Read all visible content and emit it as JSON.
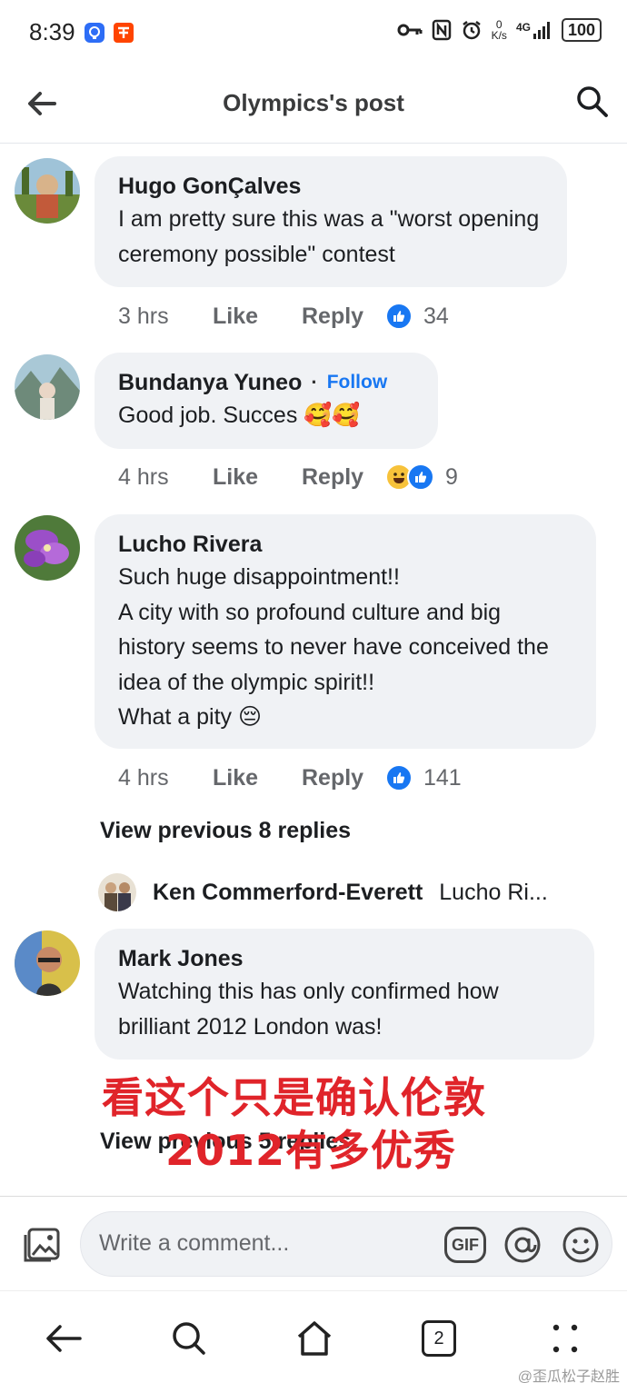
{
  "status_bar": {
    "time": "8:39",
    "net_speed_top": "0",
    "net_speed_bottom": "K/s",
    "network": "4G",
    "battery": "100"
  },
  "app_bar": {
    "title": "Olympics's post"
  },
  "comments": [
    {
      "author": "Hugo GonÇalves",
      "text": "I am pretty sure this was a \"worst opening ceremony possible\" contest",
      "time": "3 hrs",
      "like": "Like",
      "reply": "Reply",
      "reactions": [
        "like-icon"
      ],
      "count": "34"
    },
    {
      "author": "Bundanya Yuneo",
      "separator": "·",
      "follow": "Follow",
      "text": "Good job. Succes 🥰🥰",
      "time": "4 hrs",
      "like": "Like",
      "reply": "Reply",
      "reactions": [
        "haha-icon",
        "like-icon"
      ],
      "count": "9"
    },
    {
      "author": "Lucho Rivera",
      "text": "Such huge disappointment!!\nA city with so profound culture and big history seems to never have conceived the idea of the olympic spirit!!\nWhat a pity 😔",
      "time": "4 hrs",
      "like": "Like",
      "reply": "Reply",
      "reactions": [
        "like-icon"
      ],
      "count": "141"
    },
    {
      "author": "Mark Jones",
      "text": "Watching this has only confirmed how brilliant 2012 London was!"
    }
  ],
  "view_previous_1": "View previous 8 replies",
  "reply_preview": {
    "name": "Ken Commerford-Everett",
    "text": "Lucho Ri..."
  },
  "view_previous_2": "View previous 5 replies",
  "overlay": {
    "line1": "看这个只是确认伦敦",
    "line2": "2012有多优秀"
  },
  "composer": {
    "placeholder": "Write a comment...",
    "gif_label": "GIF"
  },
  "sys_nav": {
    "tabs_count": "2"
  },
  "watermark": "@歪瓜松子赵胜"
}
